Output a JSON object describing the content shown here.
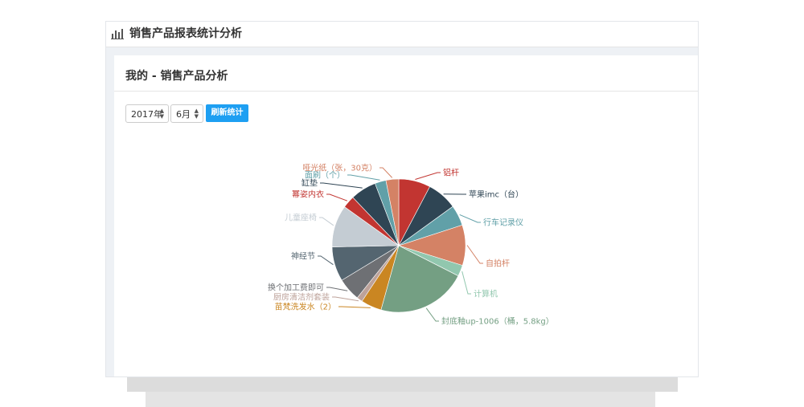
{
  "window": {
    "title": "销售产品报表统计分析"
  },
  "panel": {
    "title": "我的 - 销售产品分析"
  },
  "filters": {
    "year": "2017年",
    "month": "6月",
    "refresh_label": "刷新统计"
  },
  "icons": {
    "header": "bar-chart-icon",
    "caret": "caret-updown-icon"
  },
  "chart_data": {
    "type": "pie",
    "title": "",
    "slices": [
      {
        "label": "铝杆",
        "value": 7.7,
        "color": "#c23531"
      },
      {
        "label": "苹果imc（台）",
        "value": 7.3,
        "color": "#2f4554"
      },
      {
        "label": "行车记录仪",
        "value": 5.0,
        "color": "#61a0a8"
      },
      {
        "label": "自拍杆",
        "value": 9.8,
        "color": "#d48265"
      },
      {
        "label": "计算机",
        "value": 2.7,
        "color": "#91c7ae"
      },
      {
        "label": "封底釉up-1006（桶，5.8kg）",
        "value": 21.8,
        "color": "#749f83"
      },
      {
        "label": "苗梵洗发水（2）",
        "value": 5.0,
        "color": "#ca8622"
      },
      {
        "label": "厨房清洁剂套装",
        "value": 1.4,
        "color": "#bda29a"
      },
      {
        "label": "换个加工费即可",
        "value": 5.6,
        "color": "#6e7074"
      },
      {
        "label": "神经节",
        "value": 8.4,
        "color": "#546570"
      },
      {
        "label": "儿童座椅",
        "value": 10.2,
        "color": "#c4ccd3"
      },
      {
        "label": "幂姿内衣",
        "value": 3.0,
        "color": "#c23531"
      },
      {
        "label": "缸垫",
        "value": 6.3,
        "color": "#2f4554"
      },
      {
        "label": "面刷（个）",
        "value": 2.7,
        "color": "#61a0a8"
      },
      {
        "label": "哑光纸（张，30克）",
        "value": 3.1,
        "color": "#d48265"
      }
    ]
  }
}
